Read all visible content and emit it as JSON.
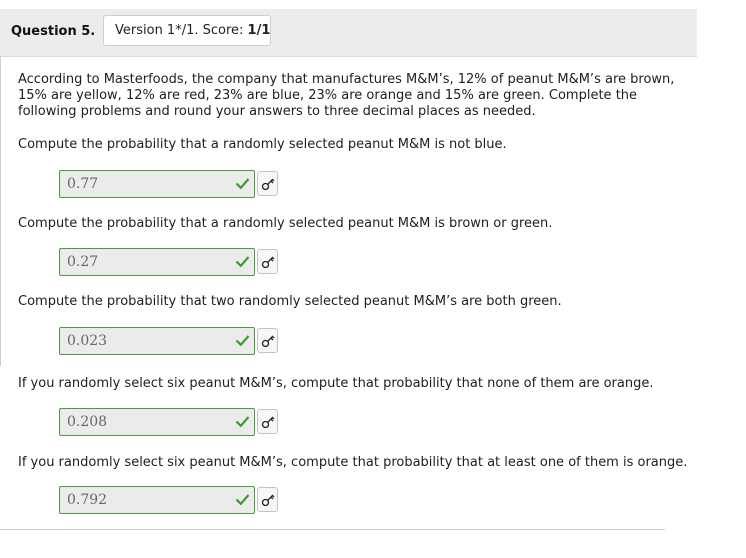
{
  "header": {
    "question_label": "Question 5.",
    "version_text": "Version 1*/1. Score: ",
    "score": "1/1"
  },
  "intro": "According to Masterfoods, the company that manufactures M&M’s, 12% of peanut M&M’s are brown, 15% are yellow, 12% are red, 23% are blue, 23% are orange and 15% are green. Complete the following problems and round your answers to three decimal places as needed.",
  "parts": [
    {
      "prompt": "Compute the probability that a randomly selected peanut M&M is not blue.",
      "answer": "0.77"
    },
    {
      "prompt": "Compute the probability that a randomly selected peanut M&M is brown or green.",
      "answer": "0.27"
    },
    {
      "prompt": "Compute the probability that two randomly selected peanut M&M’s are both green.",
      "answer": "0.023"
    },
    {
      "prompt": "If you randomly select six peanut M&M’s, compute that probability that none of them are orange.",
      "answer": "0.208"
    },
    {
      "prompt": "If you randomly select six peanut M&M’s, compute that probability that at least one of them is orange.",
      "answer": "0.792"
    }
  ],
  "icons": {
    "correct": "checkmark-icon",
    "key": "key-icon"
  },
  "colors": {
    "correct_green": "#3c9a2e",
    "answer_border": "#4a9a3e",
    "answer_bg": "#ebebeb",
    "header_bg": "#ececec"
  }
}
